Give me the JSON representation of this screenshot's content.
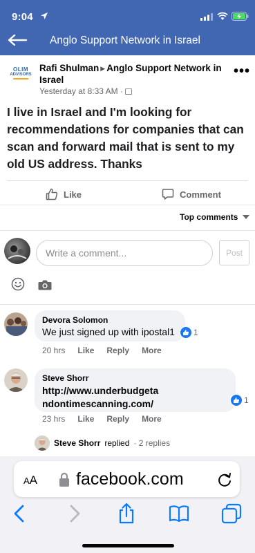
{
  "status": {
    "time": "9:04"
  },
  "header": {
    "title": "Anglo Support Network in Israel"
  },
  "post": {
    "logo_line1": "OLIM",
    "logo_line2": "ADVISORS",
    "author": "Rafi Shulman",
    "group": "Anglo Support Network in Israel",
    "time": "Yesterday at 8:33 AM ·",
    "body": "I live in Israel and I'm looking for recommendations for companies that can scan and forward mail that is sent to my old US address.  Thanks"
  },
  "actions": {
    "like": "Like",
    "comment": "Comment"
  },
  "sort": {
    "label": "Top comments"
  },
  "composer": {
    "placeholder": "Write a comment...",
    "post": "Post"
  },
  "comments": [
    {
      "name": "Devora Solomon",
      "text": "We just signed up with ipostal1",
      "reactions": "1",
      "time": "20 hrs",
      "like": "Like",
      "reply": "Reply",
      "more": "More"
    },
    {
      "name": "Steve Shorr",
      "text_line1": "http://www.underbudgeta",
      "text_line2": "ndontimescanning.com/",
      "reactions": "1",
      "time": "23 hrs",
      "like": "Like",
      "reply": "Reply",
      "more": "More"
    }
  ],
  "reply_summary": {
    "name": "Steve Shorr",
    "action": "replied",
    "count": "· 2 replies"
  },
  "browser": {
    "aa_big": "A",
    "aa_small": "A",
    "url": "facebook.com"
  },
  "colors": {
    "header_blue": "#4267b2",
    "like_blue": "#1877f2",
    "ios_blue": "#0a7aff"
  }
}
